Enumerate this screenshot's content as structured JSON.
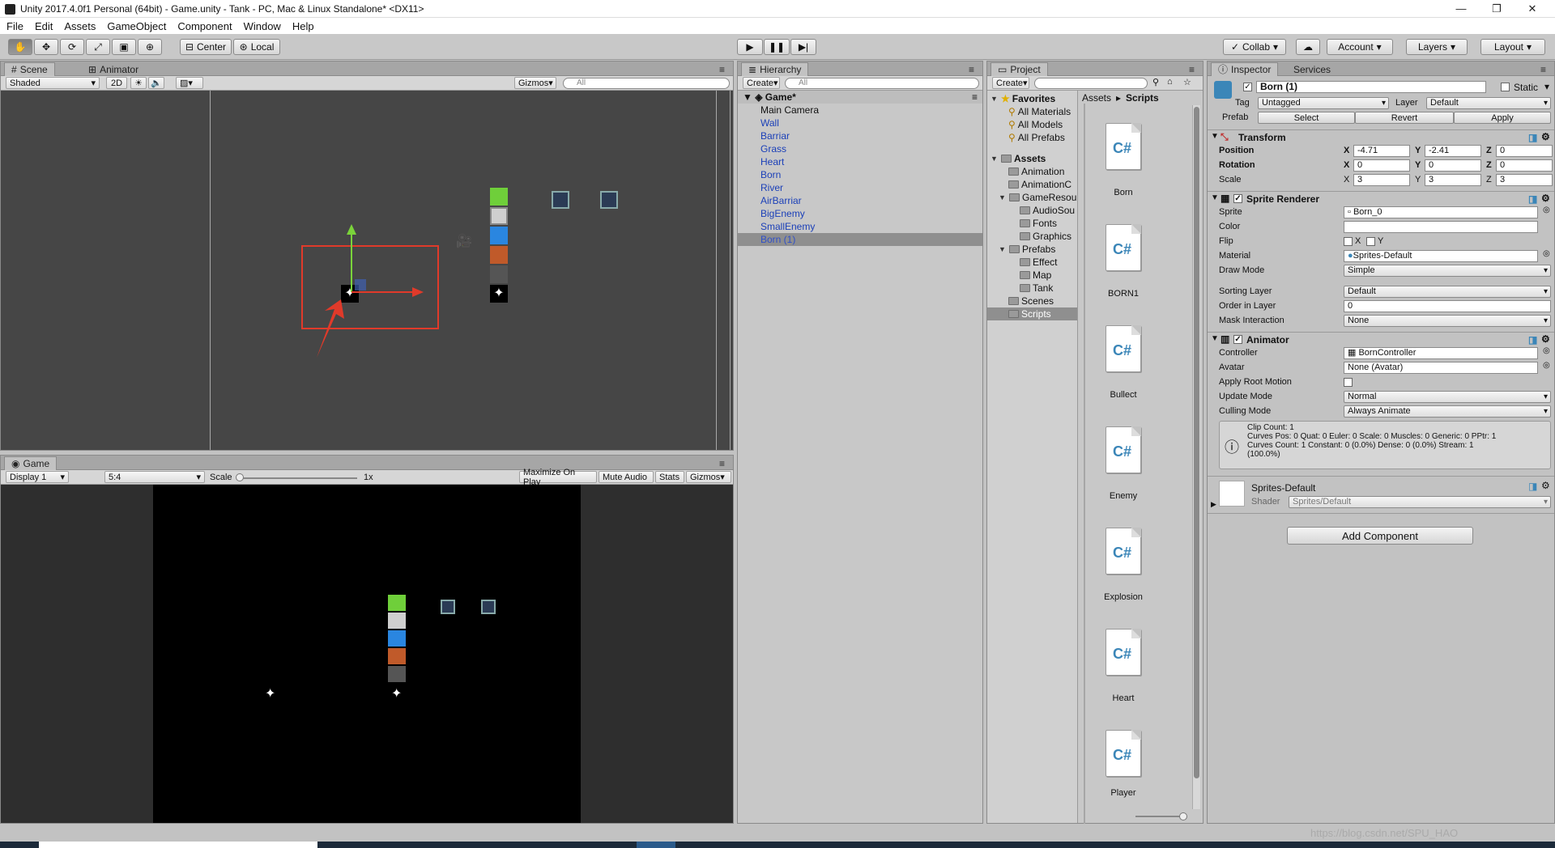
{
  "window": {
    "title": "Unity 2017.4.0f1 Personal (64bit) - Game.unity - Tank - PC, Mac & Linux Standalone* <DX11>"
  },
  "menu": [
    "File",
    "Edit",
    "Assets",
    "GameObject",
    "Component",
    "Window",
    "Help"
  ],
  "toolbar": {
    "center": "Center",
    "local": "Local",
    "collab": "Collab",
    "account": "Account",
    "layers": "Layers",
    "layout": "Layout"
  },
  "scene": {
    "tab_scene": "Scene",
    "tab_animator": "Animator",
    "shading": "Shaded",
    "mode2d": "2D",
    "gizmos": "Gizmos",
    "search_placeholder": "All"
  },
  "game": {
    "tab": "Game",
    "display": "Display 1",
    "aspect": "5:4",
    "scale_label": "Scale",
    "scale_value": "1x",
    "maximize": "Maximize On Play",
    "mute": "Mute Audio",
    "stats": "Stats",
    "gizmos": "Gizmos"
  },
  "hierarchy": {
    "tab": "Hierarchy",
    "create": "Create",
    "search": "All",
    "scene_name": "Game*",
    "items": [
      "Main Camera",
      "Wall",
      "Barriar",
      "Grass",
      "Heart",
      "Born",
      "River",
      "AirBarriar",
      "BigEnemy",
      "SmallEnemy",
      "Born (1)"
    ]
  },
  "project": {
    "tab": "Project",
    "create": "Create",
    "favorites": "Favorites",
    "fav_items": [
      "All Materials",
      "All Models",
      "All Prefabs"
    ],
    "assets": "Assets",
    "folders": [
      "Animation",
      "AnimationC",
      "GameResou",
      "AudioSou",
      "Fonts",
      "Graphics",
      "Prefabs",
      "Effect",
      "Map",
      "Tank",
      "Scenes",
      "Scripts"
    ],
    "breadcrumb_root": "Assets",
    "breadcrumb_sep": "▸",
    "breadcrumb_leaf": "Scripts",
    "scripts": [
      "Born",
      "BORN1",
      "Bullect",
      "Enemy",
      "Explosion",
      "Heart",
      "Player"
    ],
    "script_icon": "C#"
  },
  "inspector": {
    "tab": "Inspector",
    "tab_services": "Services",
    "object_name": "Born (1)",
    "static": "Static",
    "tag_label": "Tag",
    "tag_value": "Untagged",
    "layer_label": "Layer",
    "layer_value": "Default",
    "prefab_label": "Prefab",
    "prefab_select": "Select",
    "prefab_revert": "Revert",
    "prefab_apply": "Apply",
    "transform": {
      "title": "Transform",
      "position": "Position",
      "rotation": "Rotation",
      "scale": "Scale",
      "x": "X",
      "y": "Y",
      "z": "Z",
      "pos": [
        "-4.71",
        "-2.41",
        "0"
      ],
      "rot": [
        "0",
        "0",
        "0"
      ],
      "scl": [
        "3",
        "3",
        "3"
      ]
    },
    "sprite_renderer": {
      "title": "Sprite Renderer",
      "sprite_label": "Sprite",
      "sprite": "Born_0",
      "color_label": "Color",
      "flip_label": "Flip",
      "flip_x": "X",
      "flip_y": "Y",
      "material_label": "Material",
      "material": "Sprites-Default",
      "draw_mode_label": "Draw Mode",
      "draw_mode": "Simple",
      "sorting_layer_label": "Sorting Layer",
      "sorting_layer": "Default",
      "order_label": "Order in Layer",
      "order": "0",
      "mask_label": "Mask Interaction",
      "mask": "None"
    },
    "animator": {
      "title": "Animator",
      "controller_label": "Controller",
      "controller": "BornController",
      "avatar_label": "Avatar",
      "avatar": "None (Avatar)",
      "root_motion_label": "Apply Root Motion",
      "update_label": "Update Mode",
      "update": "Normal",
      "culling_label": "Culling Mode",
      "culling": "Always Animate",
      "info": [
        "Clip Count: 1",
        "Curves Pos: 0 Quat: 0 Euler: 0 Scale: 0 Muscles: 0 Generic: 0 PPtr: 1",
        "Curves Count: 1 Constant: 0 (0.0%) Dense: 0 (0.0%) Stream: 1",
        "(100.0%)"
      ]
    },
    "material": {
      "name": "Sprites-Default",
      "shader_label": "Shader",
      "shader": "Sprites/Default"
    },
    "add_component": "Add Component"
  },
  "statusbar": {
    "watermark": "https://blog.csdn.net/SPU_HAO"
  },
  "colors": {
    "play_blue": "#1a3fb8",
    "selection": "#3050c8",
    "gizmo_red": "#e03a2a",
    "gizmo_green": "#7ad33a"
  }
}
